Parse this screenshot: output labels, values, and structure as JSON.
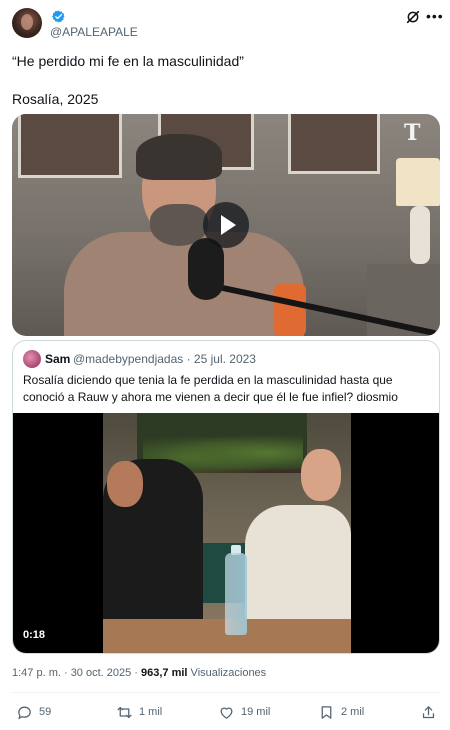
{
  "author": {
    "handle": "@APALEAPALE",
    "verified": true
  },
  "tweet": {
    "text": "“He perdido mi fe en la masculinidad”\n\nRosalía, 2025"
  },
  "media": {
    "watermark": "T"
  },
  "quoted_tweet": {
    "name": "Sam",
    "meta": "@madebypendjadas · 25 jul. 2023",
    "text": "Rosalía diciendo que tenia la fe perdida en la masculinidad hasta que conoció a Rauw y ahora me vienen a decir que él le fue infiel? diosmio",
    "video_duration": "0:18"
  },
  "stats": {
    "time": "1:47 p. m. · 30 oct. 2025 · ",
    "views_count": "963,7 mil",
    "views_label": " Visualizaciones"
  },
  "actions": {
    "replies": "59",
    "reposts": "1 mil",
    "likes": "19 mil",
    "bookmarks": "2 mil"
  },
  "colors": {
    "verified": "#1d9bf0",
    "secondary_text": "#536471",
    "border": "#cfd9de"
  },
  "icons": [
    "verified-badge-icon",
    "grok-icon",
    "more-icon",
    "play-icon",
    "reply-icon",
    "repost-icon",
    "like-icon",
    "bookmark-icon",
    "share-icon"
  ]
}
